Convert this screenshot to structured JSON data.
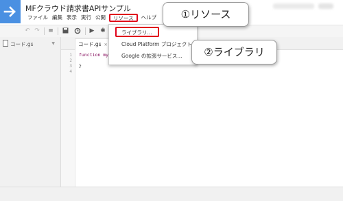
{
  "header": {
    "title": "MFクラウド請求書APIサンプル",
    "menu": [
      {
        "label": "ファイル"
      },
      {
        "label": "編集"
      },
      {
        "label": "表示"
      },
      {
        "label": "実行"
      },
      {
        "label": "公開"
      },
      {
        "label": "リソース",
        "active": true
      },
      {
        "label": "ヘルプ"
      }
    ]
  },
  "toolbar": {
    "icons": [
      "undo-icon",
      "redo-icon",
      "indent-icon",
      "save-icon",
      "history-icon",
      "run-icon",
      "debug-icon"
    ]
  },
  "sidebar": {
    "file_label": "コード.gs"
  },
  "editor": {
    "tab_label": "コード.gs",
    "lines": [
      {
        "no": "1",
        "text": "function my"
      },
      {
        "no": "2",
        "text": ""
      },
      {
        "no": "3",
        "text": "}"
      },
      {
        "no": "4",
        "text": ""
      }
    ]
  },
  "dropdown": {
    "items": [
      {
        "label": "ライブラリ..."
      },
      {
        "label": "Cloud Platform プロジェクト..."
      },
      {
        "label": "Google の拡張サービス..."
      }
    ]
  },
  "callouts": {
    "step1": "①リソース",
    "step2": "②ライブラリ"
  },
  "colors": {
    "highlight": "#e0001a",
    "logo": "#4a90e2"
  }
}
